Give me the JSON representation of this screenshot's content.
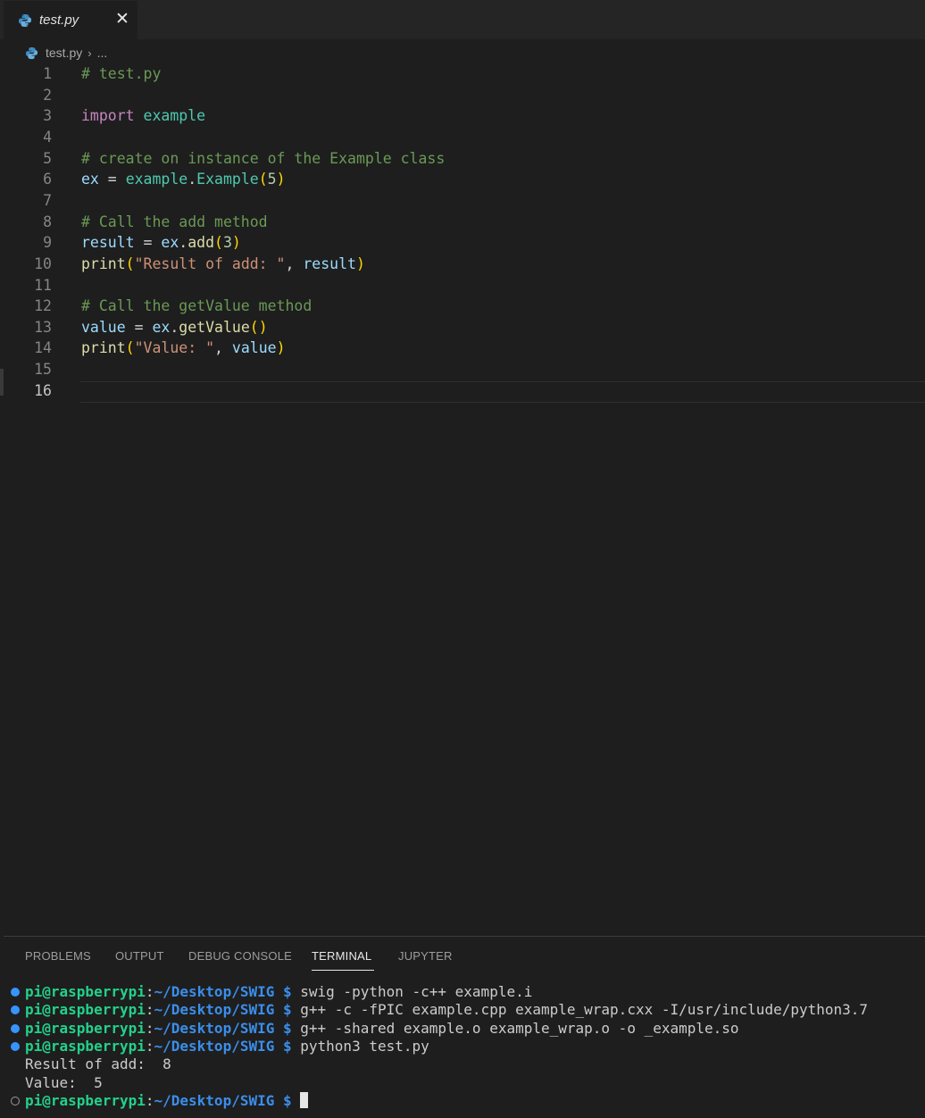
{
  "tab": {
    "label": "test.py",
    "close": "✕"
  },
  "breadcrumb": {
    "file": "test.py",
    "more": "..."
  },
  "editor": {
    "lines": [
      {
        "num": "1",
        "parts": [
          {
            "t": "# test.py",
            "c": "com"
          }
        ]
      },
      {
        "num": "2",
        "parts": []
      },
      {
        "num": "3",
        "parts": [
          {
            "t": "import",
            "c": "kw"
          },
          {
            "t": " ",
            "c": "op"
          },
          {
            "t": "example",
            "c": "mod"
          }
        ]
      },
      {
        "num": "4",
        "parts": []
      },
      {
        "num": "5",
        "parts": [
          {
            "t": "# create on instance of the Example class",
            "c": "com"
          }
        ]
      },
      {
        "num": "6",
        "parts": [
          {
            "t": "ex",
            "c": "var"
          },
          {
            "t": " = ",
            "c": "op"
          },
          {
            "t": "example",
            "c": "mod"
          },
          {
            "t": ".",
            "c": "op"
          },
          {
            "t": "Example",
            "c": "mod"
          },
          {
            "t": "(",
            "c": "br"
          },
          {
            "t": "5",
            "c": "num"
          },
          {
            "t": ")",
            "c": "br"
          }
        ]
      },
      {
        "num": "7",
        "parts": []
      },
      {
        "num": "8",
        "parts": [
          {
            "t": "# Call the add method",
            "c": "com"
          }
        ]
      },
      {
        "num": "9",
        "parts": [
          {
            "t": "result",
            "c": "var"
          },
          {
            "t": " = ",
            "c": "op"
          },
          {
            "t": "ex",
            "c": "var"
          },
          {
            "t": ".",
            "c": "op"
          },
          {
            "t": "add",
            "c": "fn"
          },
          {
            "t": "(",
            "c": "br"
          },
          {
            "t": "3",
            "c": "num"
          },
          {
            "t": ")",
            "c": "br"
          }
        ]
      },
      {
        "num": "10",
        "parts": [
          {
            "t": "print",
            "c": "fn"
          },
          {
            "t": "(",
            "c": "br"
          },
          {
            "t": "\"Result of add: \"",
            "c": "str"
          },
          {
            "t": ", ",
            "c": "op"
          },
          {
            "t": "result",
            "c": "var"
          },
          {
            "t": ")",
            "c": "br"
          }
        ]
      },
      {
        "num": "11",
        "parts": []
      },
      {
        "num": "12",
        "parts": [
          {
            "t": "# Call the getValue method",
            "c": "com"
          }
        ]
      },
      {
        "num": "13",
        "parts": [
          {
            "t": "value",
            "c": "var"
          },
          {
            "t": " = ",
            "c": "op"
          },
          {
            "t": "ex",
            "c": "var"
          },
          {
            "t": ".",
            "c": "op"
          },
          {
            "t": "getValue",
            "c": "fn"
          },
          {
            "t": "()",
            "c": "br"
          }
        ]
      },
      {
        "num": "14",
        "parts": [
          {
            "t": "print",
            "c": "fn"
          },
          {
            "t": "(",
            "c": "br"
          },
          {
            "t": "\"Value: \"",
            "c": "str"
          },
          {
            "t": ", ",
            "c": "op"
          },
          {
            "t": "value",
            "c": "var"
          },
          {
            "t": ")",
            "c": "br"
          }
        ]
      },
      {
        "num": "15",
        "parts": []
      },
      {
        "num": "16",
        "parts": [],
        "active": true
      }
    ]
  },
  "panel": {
    "tabs": [
      {
        "label": "PROBLEMS",
        "name": "tab-problems"
      },
      {
        "label": "OUTPUT",
        "name": "tab-output"
      },
      {
        "label": "DEBUG CONSOLE",
        "name": "tab-debug-console"
      },
      {
        "label": "TERMINAL",
        "name": "tab-terminal",
        "active": true
      },
      {
        "label": "JUPYTER",
        "name": "tab-jupyter"
      }
    ],
    "terminal": {
      "lines": [
        {
          "type": "cmd",
          "dot": "filled",
          "user": "pi@raspberrypi",
          "sep": ":",
          "path": "~/Desktop/SWIG",
          "prompt": " $ ",
          "cmd": "swig -python -c++ example.i"
        },
        {
          "type": "cmd",
          "dot": "filled",
          "user": "pi@raspberrypi",
          "sep": ":",
          "path": "~/Desktop/SWIG",
          "prompt": " $ ",
          "cmd": "g++ -c -fPIC example.cpp example_wrap.cxx -I/usr/include/python3.7"
        },
        {
          "type": "cmd",
          "dot": "filled",
          "user": "pi@raspberrypi",
          "sep": ":",
          "path": "~/Desktop/SWIG",
          "prompt": " $ ",
          "cmd": "g++ -shared example.o example_wrap.o -o _example.so"
        },
        {
          "type": "cmd",
          "dot": "filled",
          "user": "pi@raspberrypi",
          "sep": ":",
          "path": "~/Desktop/SWIG",
          "prompt": " $ ",
          "cmd": "python3 test.py"
        },
        {
          "type": "out",
          "text": "Result of add:  8"
        },
        {
          "type": "out",
          "text": "Value:  5"
        },
        {
          "type": "cmd",
          "dot": "empty",
          "user": "pi@raspberrypi",
          "sep": ":",
          "path": "~/Desktop/SWIG",
          "prompt": " $ ",
          "cmd": "",
          "cursor": true
        }
      ]
    }
  },
  "colors": {
    "background": "#1e1e1e",
    "comment": "#6a9955",
    "keyword": "#c586c0",
    "module": "#4ec9b0",
    "variable": "#9cdcfe",
    "function": "#dcdcaa",
    "string": "#ce9178",
    "number": "#b5cea8",
    "bracket": "#ffd700",
    "terminal_user": "#23d18b",
    "terminal_path": "#3b8eea"
  }
}
